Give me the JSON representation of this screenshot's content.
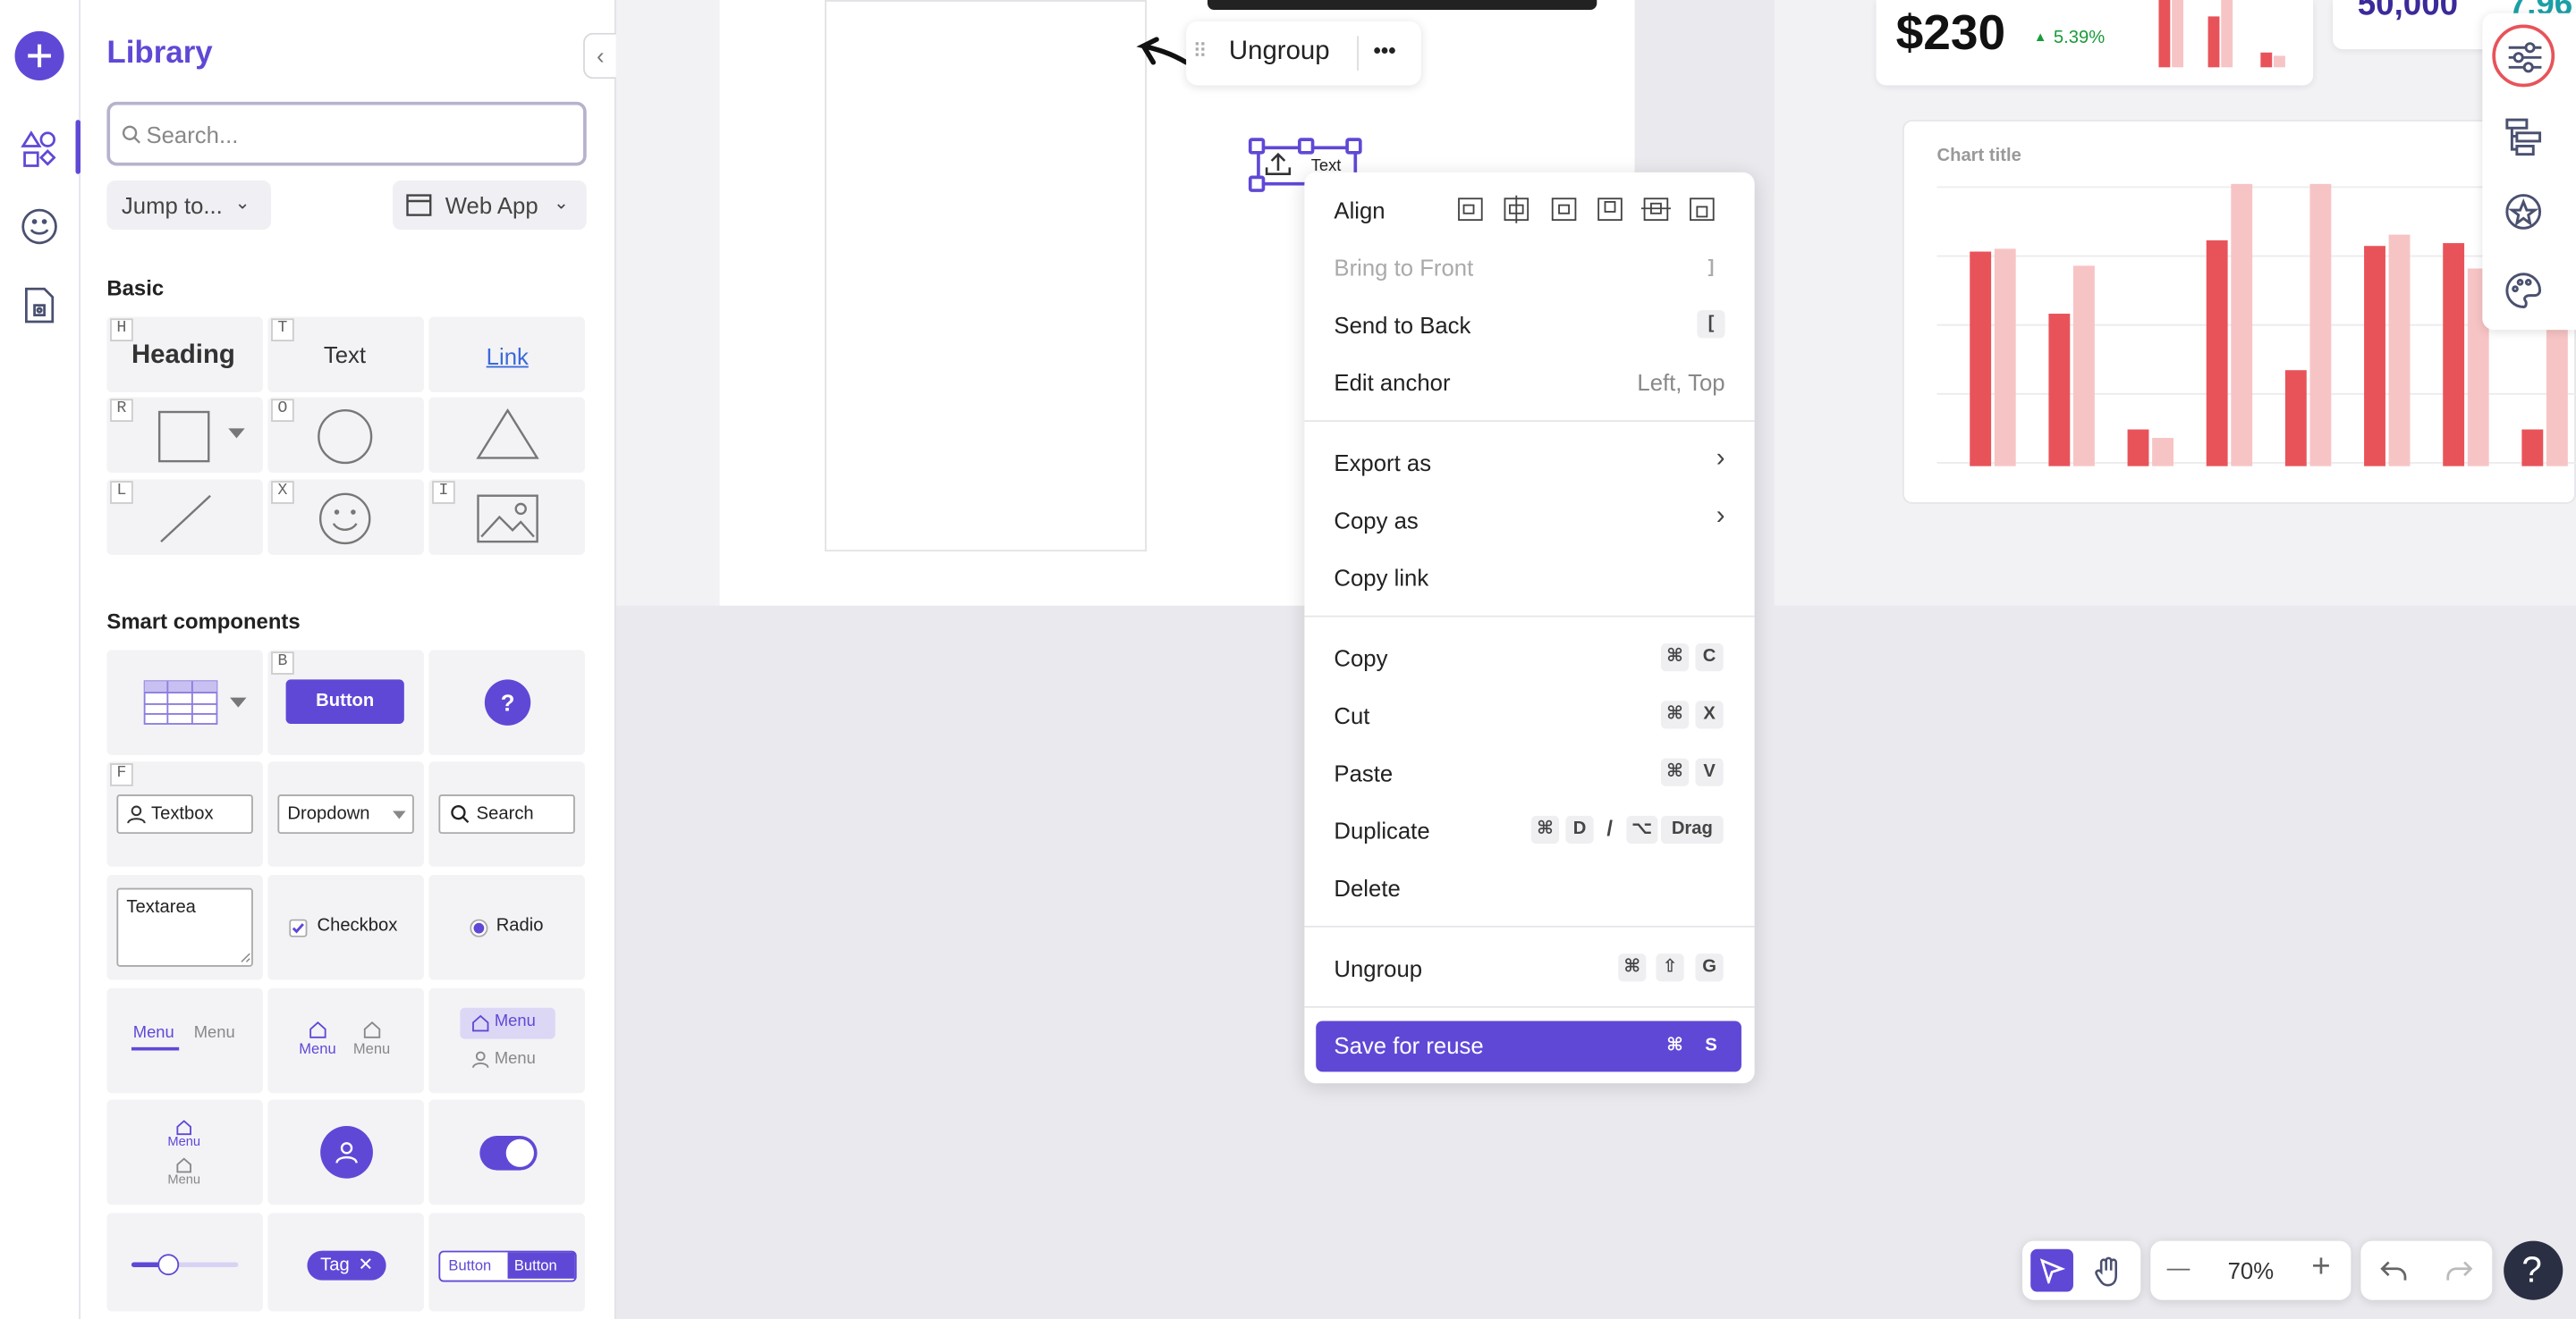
{
  "library": {
    "title": "Library",
    "search_placeholder": "Search...",
    "jump_to": "Jump to...",
    "web_app": "Web App",
    "sections": {
      "basic": "Basic",
      "smart": "Smart components"
    },
    "basic_tiles": {
      "heading": {
        "key": "H",
        "label": "Heading"
      },
      "text": {
        "key": "T",
        "label": "Text"
      },
      "link": {
        "label": "Link"
      },
      "rect": {
        "key": "R"
      },
      "oval": {
        "key": "O"
      },
      "line": {
        "key": "L"
      },
      "emoji": {
        "key": "X"
      },
      "image": {
        "key": "I"
      }
    },
    "smart_tiles": {
      "button_key": "B",
      "button": "Button",
      "help": "?",
      "textbox_key": "F",
      "textbox": "Textbox",
      "dropdown": "Dropdown",
      "search": "Search",
      "textarea": "Textarea",
      "checkbox": "Checkbox",
      "radio": "Radio",
      "menu": "Menu",
      "tag": "Tag",
      "button_group_a": "Button",
      "button_group_b": "Button"
    }
  },
  "toolbar": {
    "ungroup": "Ungroup",
    "more": "•••"
  },
  "selection": {
    "label": "Text"
  },
  "dashboard": {
    "price": "$230",
    "change": "5.39%",
    "number_a": "50,000",
    "number_b": "7,96",
    "chart_title": "Chart title"
  },
  "chart_data": {
    "type": "bar",
    "title": "Chart title",
    "series": [
      {
        "color": "#e8535a",
        "values": [
          0.76,
          0.54,
          0.13,
          0.8,
          0.34,
          0.78,
          0.79,
          0.13
        ]
      },
      {
        "color": "#f7c4c5",
        "values": [
          0.77,
          0.71,
          0.1,
          1.0,
          1.0,
          0.82,
          0.7,
          0.9
        ]
      }
    ],
    "ylim": [
      0,
      1
    ]
  },
  "menu": {
    "align": "Align",
    "bring_front": "Bring to Front",
    "bring_front_key": "]",
    "send_back": "Send to Back",
    "send_back_key": "[",
    "edit_anchor": "Edit anchor",
    "edit_anchor_value": "Left, Top",
    "export_as": "Export as",
    "copy_as": "Copy as",
    "copy_link": "Copy link",
    "copy": "Copy",
    "cut": "Cut",
    "paste": "Paste",
    "duplicate": "Duplicate",
    "delete": "Delete",
    "ungroup": "Ungroup",
    "save_reuse": "Save for reuse",
    "keys": {
      "cmd": "⌘",
      "c": "C",
      "x": "X",
      "v": "V",
      "d": "D",
      "slash": "/",
      "opt": "⌥",
      "drag": "Drag",
      "shift": "⇧",
      "g": "G",
      "s": "S"
    }
  },
  "zoom": {
    "level": "70%",
    "minus": "—",
    "plus": "+"
  },
  "help": "?",
  "colors": {
    "accent": "#6048d6",
    "bar_dark": "#e8535a",
    "bar_light": "#f7c4c5"
  }
}
